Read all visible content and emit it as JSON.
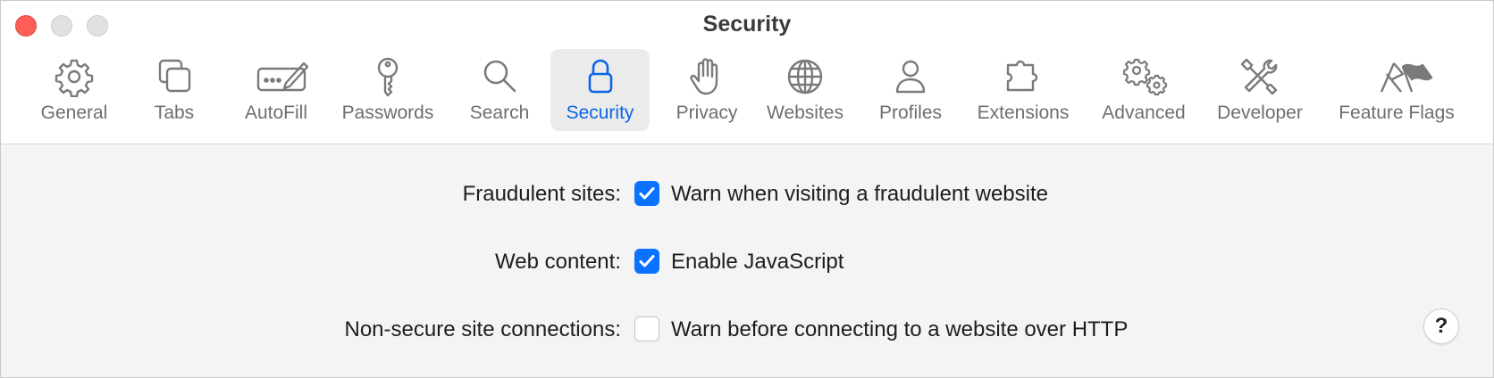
{
  "window": {
    "title": "Security"
  },
  "toolbar": {
    "tabs": [
      {
        "label": "General",
        "icon": "gear-icon"
      },
      {
        "label": "Tabs",
        "icon": "tabs-icon"
      },
      {
        "label": "AutoFill",
        "icon": "autofill-icon"
      },
      {
        "label": "Passwords",
        "icon": "key-icon"
      },
      {
        "label": "Search",
        "icon": "magnifier-icon"
      },
      {
        "label": "Security",
        "icon": "lock-icon",
        "selected": true
      },
      {
        "label": "Privacy",
        "icon": "hand-icon"
      },
      {
        "label": "Websites",
        "icon": "globe-icon"
      },
      {
        "label": "Profiles",
        "icon": "person-icon"
      },
      {
        "label": "Extensions",
        "icon": "puzzle-icon"
      },
      {
        "label": "Advanced",
        "icon": "gears-icon"
      },
      {
        "label": "Developer",
        "icon": "tools-icon"
      },
      {
        "label": "Feature Flags",
        "icon": "flags-icon"
      }
    ]
  },
  "settings": [
    {
      "label": "Fraudulent sites:",
      "option": "Warn when visiting a fraudulent website",
      "checked": true
    },
    {
      "label": "Web content:",
      "option": "Enable JavaScript",
      "checked": true
    },
    {
      "label": "Non-secure site connections:",
      "option": "Warn before connecting to a website over HTTP",
      "checked": false
    }
  ],
  "help": {
    "label": "?"
  },
  "colors": {
    "accent": "#0a66e6",
    "checkbox_on": "#0a72ff",
    "close": "#fe5f57"
  }
}
